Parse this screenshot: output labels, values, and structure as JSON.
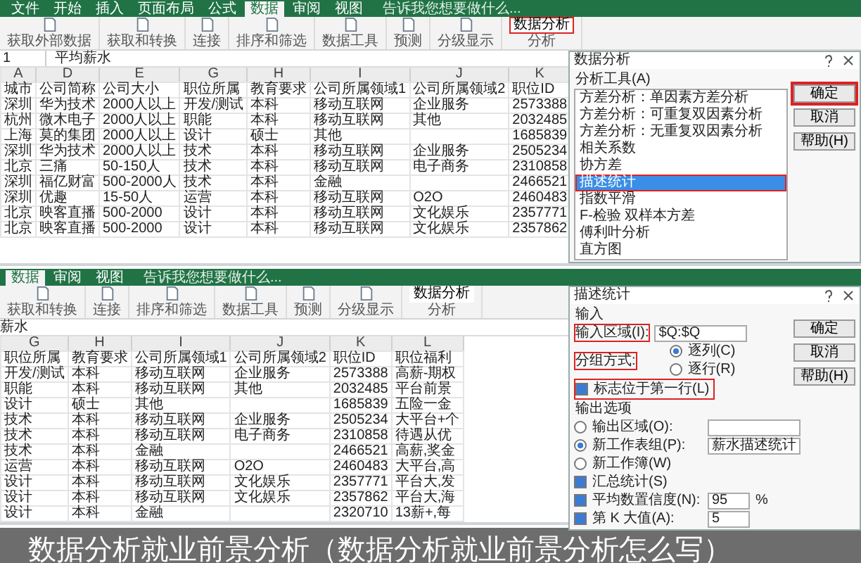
{
  "screenshots": [
    {
      "tabs": [
        {
          "label": "文件",
          "selected": false
        },
        {
          "label": "开始",
          "selected": false
        },
        {
          "label": "插入",
          "selected": false
        },
        {
          "label": "页面布局",
          "selected": false
        },
        {
          "label": "公式",
          "selected": false
        },
        {
          "label": "数据",
          "selected": true
        },
        {
          "label": "审阅",
          "selected": false
        },
        {
          "label": "视图",
          "selected": false
        }
      ],
      "tell_me": "告诉我您想要做什么...",
      "ribbon_groups": [
        {
          "label": "获取外部数据"
        },
        {
          "label": "获取和转换"
        },
        {
          "label": "连接"
        },
        {
          "label": "排序和筛选"
        },
        {
          "label": "数据工具"
        },
        {
          "label": "预测"
        },
        {
          "label": "分级显示"
        },
        {
          "label": "分析",
          "button": {
            "label": "数据分析",
            "highlighted": true
          }
        }
      ],
      "name_box": "1",
      "formula": "平均薪水",
      "columns": [
        {
          "letter": "A",
          "header": "城市"
        },
        {
          "letter": "D",
          "header": "公司简称"
        },
        {
          "letter": "E",
          "header": "公司大小"
        },
        {
          "letter": "G",
          "header": "职位所属"
        },
        {
          "letter": "H",
          "header": "教育要求"
        },
        {
          "letter": "I",
          "header": "公司所属领域1"
        },
        {
          "letter": "J",
          "header": "公司所属领域2"
        },
        {
          "letter": "K",
          "header": "职位ID"
        }
      ],
      "rows": [
        [
          "深圳",
          "华为技术",
          "2000人以上",
          "开发/测试",
          "本科",
          "移动互联网",
          "企业服务",
          "2573388"
        ],
        [
          "杭州",
          "微木电子",
          "2000人以上",
          "职能",
          "本科",
          "移动互联网",
          "其他",
          "2032485"
        ],
        [
          "上海",
          "莫的集团",
          "2000人以上",
          "设计",
          "硕士",
          "其他",
          null,
          "1685839"
        ],
        [
          "深圳",
          "华为技术",
          "2000人以上",
          "技术",
          "本科",
          "移动互联网",
          "企业服务",
          "2505234"
        ],
        [
          "北京",
          "三痛",
          "50-150人",
          "技术",
          "本科",
          "移动互联网",
          "电子商务",
          "2310858"
        ],
        [
          "深圳",
          "福亿财富",
          "500-2000人",
          "技术",
          "本科",
          "金融",
          null,
          "2466521"
        ],
        [
          "深圳",
          "优趣",
          "15-50人",
          "运营",
          "本科",
          "移动互联网",
          "O2O",
          "2460483"
        ],
        [
          "北京",
          "映客直播",
          "500-2000",
          "设计",
          "本科",
          "移动互联网",
          "文化娱乐",
          "2357771"
        ],
        [
          "北京",
          "映客直播",
          "500-2000",
          "设计",
          "本科",
          "移动互联网",
          "文化娱乐",
          "2357862"
        ]
      ],
      "dialog": {
        "kind": "tool_list",
        "title": "数据分析",
        "list_label": "分析工具(A)",
        "items": [
          {
            "label": "方差分析：单因素方差分析",
            "selected": false,
            "highlighted": false
          },
          {
            "label": "方差分析：可重复双因素分析",
            "selected": false,
            "highlighted": false
          },
          {
            "label": "方差分析：无重复双因素分析",
            "selected": false,
            "highlighted": false
          },
          {
            "label": "相关系数",
            "selected": false,
            "highlighted": false
          },
          {
            "label": "协方差",
            "selected": false,
            "highlighted": false
          },
          {
            "label": "描述统计",
            "selected": true,
            "highlighted": true
          },
          {
            "label": "指数平滑",
            "selected": false,
            "highlighted": false
          },
          {
            "label": "F-检验 双样本方差",
            "selected": false,
            "highlighted": false
          },
          {
            "label": "傅利叶分析",
            "selected": false,
            "highlighted": false
          },
          {
            "label": "直方图",
            "selected": false,
            "highlighted": false
          }
        ],
        "buttons": [
          {
            "label": "确定",
            "highlighted": true
          },
          {
            "label": "取消",
            "highlighted": false
          },
          {
            "label": "帮助(H)",
            "highlighted": false
          }
        ]
      }
    },
    {
      "tabs": [
        {
          "label": "数据",
          "selected": true
        },
        {
          "label": "审阅",
          "selected": false
        },
        {
          "label": "视图",
          "selected": false
        }
      ],
      "tell_me": "告诉我您想要做什么...",
      "ribbon_groups": [
        {
          "label": "获取和转换"
        },
        {
          "label": "连接"
        },
        {
          "label": "排序和筛选"
        },
        {
          "label": "数据工具"
        },
        {
          "label": "预测"
        },
        {
          "label": "分级显示"
        },
        {
          "label": "分析",
          "button": {
            "label": "数据分析",
            "highlighted": false
          }
        }
      ],
      "formula": "薪水",
      "columns": [
        {
          "letter": "G",
          "header": "职位所属"
        },
        {
          "letter": "H",
          "header": "教育要求"
        },
        {
          "letter": "I",
          "header": "公司所属领域1"
        },
        {
          "letter": "J",
          "header": "公司所属领域2"
        },
        {
          "letter": "K",
          "header": "职位ID"
        },
        {
          "letter": "L",
          "header": "职位福利"
        }
      ],
      "rows": [
        [
          "开发/测试",
          "本科",
          "移动互联网",
          "企业服务",
          "2573388",
          "高薪-期权"
        ],
        [
          "职能",
          "本科",
          "移动互联网",
          "其他",
          "2032485",
          "平台前景"
        ],
        [
          "设计",
          "硕士",
          "其他",
          null,
          "1685839",
          "五险一金"
        ],
        [
          "技术",
          "本科",
          "移动互联网",
          "企业服务",
          "2505234",
          "大平台+个"
        ],
        [
          "技术",
          "本科",
          "移动互联网",
          "电子商务",
          "2310858",
          "待遇从优"
        ],
        [
          "技术",
          "本科",
          "金融",
          null,
          "2466521",
          "高薪,奖金"
        ],
        [
          "运营",
          "本科",
          "移动互联网",
          "O2O",
          "2460483",
          "大平台,高"
        ],
        [
          "设计",
          "本科",
          "移动互联网",
          "文化娱乐",
          "2357771",
          "平台大,发"
        ],
        [
          "设计",
          "本科",
          "移动互联网",
          "文化娱乐",
          "2357862",
          "平台大,海"
        ],
        [
          "设计",
          "本科",
          "金融",
          null,
          "2320710",
          "13薪+,每"
        ]
      ],
      "dialog": {
        "kind": "descriptive",
        "title": "描述统计",
        "input_heading": "输入",
        "input_range": {
          "label": "输入区域(I):",
          "value": "$Q:$Q",
          "highlighted": true
        },
        "grouping": {
          "label": "分组方式:",
          "highlighted": true,
          "options": [
            {
              "label": "逐列(C)",
              "selected": true
            },
            {
              "label": "逐行(R)",
              "selected": false
            }
          ]
        },
        "labels_first_row": {
          "label": "标志位于第一行(L)",
          "checked": true,
          "highlighted": true
        },
        "output_heading": "输出选项",
        "outputs": [
          {
            "label": "输出区域(O):",
            "selected": false,
            "field": true
          },
          {
            "label": "新工作表组(P):",
            "selected": true,
            "value": "薪水描述统计"
          },
          {
            "label": "新工作簿(W)",
            "selected": false
          }
        ],
        "stats": [
          {
            "label": "汇总统计(S)",
            "checked": true
          },
          {
            "label": "平均数置信度(N):",
            "checked": true,
            "value": "95",
            "unit": "%"
          },
          {
            "label": "第 K 大值(A):",
            "checked": true,
            "value": "5"
          }
        ],
        "buttons": [
          {
            "label": "确定",
            "highlighted": false
          },
          {
            "label": "取消",
            "highlighted": false
          },
          {
            "label": "帮助(H)",
            "highlighted": false
          }
        ]
      }
    }
  ],
  "caption": "数据分析就业前景分析（数据分析就业前景分析怎么写）"
}
